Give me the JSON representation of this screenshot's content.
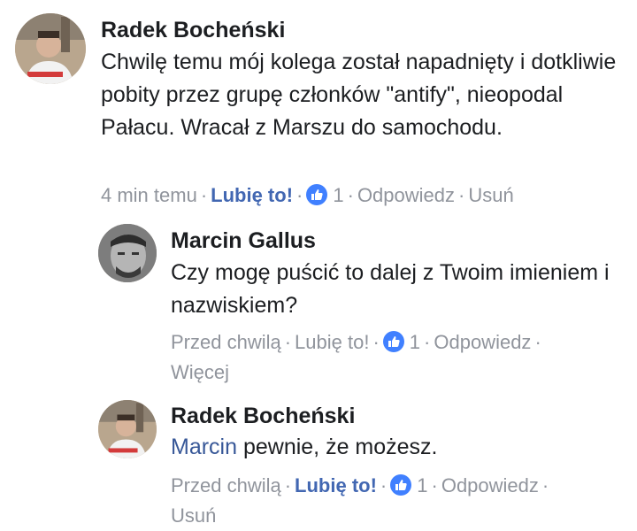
{
  "comments": [
    {
      "author": "Radek Bocheński",
      "text": "Chwilę temu mój kolega został napadnięty i dotkliwie pobity przez grupę członków \"antify\", nieopodal Pałacu. Wracał z Marszu do samochodu.",
      "time": "4 min temu",
      "like_label": "Lubię to!",
      "like_count": "1",
      "reply_label": "Odpowiedz",
      "extra_label": "Usuń",
      "separator": "·"
    },
    {
      "author": "Marcin Gallus",
      "text": "Czy mogę puścić to dalej z Twoim imieniem i nazwiskiem?",
      "time": "Przed chwilą",
      "like_label": "Lubię to!",
      "like_count": "1",
      "reply_label": "Odpowiedz",
      "extra_label": "Więcej",
      "separator": "·"
    },
    {
      "author": "Radek Bocheński",
      "mention": "Marcin",
      "text": " pewnie, że możesz.",
      "time": "Przed chwilą",
      "like_label": "Lubię to!",
      "like_count": "1",
      "reply_label": "Odpowiedz",
      "extra_label": "Usuń",
      "separator": "·"
    }
  ],
  "colors": {
    "link_active": "#4267b2",
    "meta_gray": "#90949c",
    "like_badge": "#4080ff",
    "mention": "#385898"
  },
  "icons": {
    "like_badge": "thumbs-up-icon"
  }
}
